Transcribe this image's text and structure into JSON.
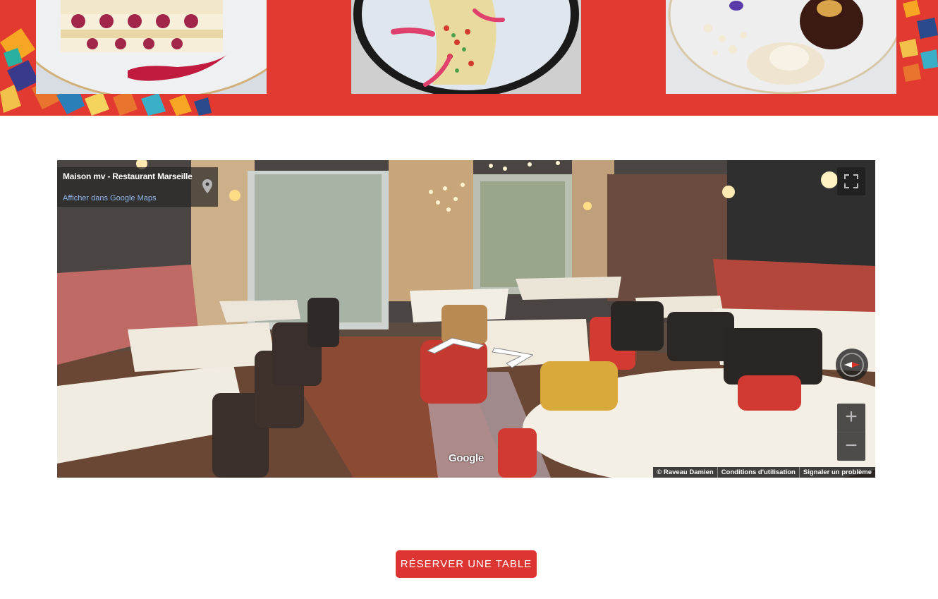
{
  "streetview": {
    "place_name": "Maison mv - Restaurant Marseille",
    "maps_link": "Afficher dans Google Maps",
    "google_logo": "Google",
    "footer": {
      "copyright": "© Raveau Damien",
      "terms": "Conditions d'utilisation",
      "report": "Signaler un problème"
    },
    "zoom_in": "+",
    "zoom_out": "−"
  },
  "cta": {
    "label": "RÉSERVER UNE TABLE"
  },
  "icons": {
    "pin": "map-pin-icon",
    "fullscreen": "fullscreen-icon",
    "compass": "compass-icon",
    "nav": "navigation-arrow-icon"
  },
  "colors": {
    "banner_red": "#e23a30",
    "button_red": "#dd3531",
    "link_blue": "#8fb5ea"
  }
}
